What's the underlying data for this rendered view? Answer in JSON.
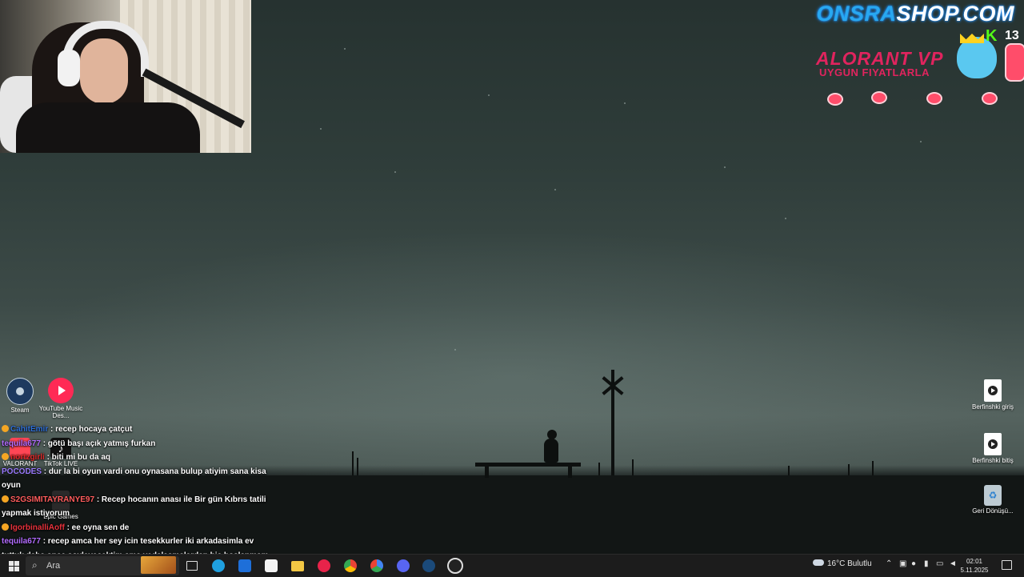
{
  "overlay": {
    "site_pre": "ONSRA",
    "site_post": "SHOP.COM",
    "game": "ALORANT VP",
    "subtitle": "UYGUN FIYATLARLA",
    "platform_letter": "K",
    "platform_number": "13"
  },
  "desktop_icons": [
    {
      "label": "Steam",
      "icon": "steam-icon"
    },
    {
      "label": "YouTube Music Des...",
      "icon": "youtube-music-icon"
    },
    {
      "label": "VALORANT",
      "icon": "valorant-icon"
    },
    {
      "label": "TikTok LIVE",
      "icon": "tiktok-icon"
    },
    {
      "label": "Epic Games",
      "icon": "epic-games-icon"
    },
    {
      "label": "Berfinshki giriş",
      "icon": "video-file-icon"
    },
    {
      "label": "Berfinshki bitiş",
      "icon": "video-file-icon"
    },
    {
      "label": "Geri Dönüşü...",
      "icon": "recycle-bin-icon"
    }
  ],
  "chat": {
    "messages": [
      {
        "user": "CahitEmir",
        "text": ": recep hocaya çatçut",
        "color": "#2f6fd6"
      },
      {
        "user": "tequila677",
        "text": ": götü başı açık yatmış furkan",
        "color": "#b26cff"
      },
      {
        "user": "nortzgirli",
        "text": ": biti mi bu da aq",
        "color": "#e02a2a"
      },
      {
        "user": "POCODES",
        "text": ": dur la bi oyun vardi onu oynasana bulup atiyim sana kisa oyun",
        "color": "#9b7bff"
      },
      {
        "user": "S2GSIMITAYRANYE97",
        "text": ": Recep hocanın anası ile Bir gün Kıbrıs tatili yapmak istiyorum",
        "color": "#ff5c5c"
      },
      {
        "user": "IgorbinalliAoff",
        "text": ": ee oyna sen de",
        "color": "#e8323c"
      },
      {
        "user": "tequila677",
        "text": ": recep amca her sey icin tesekkurler iki arkadasimla ev tuttuk daha once soyleyecektim ama vedalasmalardan hic hoslanmam bence sıkıntının tek sebebi yalnızlık",
        "color": "#b26cff"
      }
    ]
  },
  "taskbar": {
    "search_placeholder": "Ara",
    "weather": "16°C Bulutlu",
    "time": "02:01",
    "date": "5.11.2025",
    "apps": [
      {
        "name": "task-view-icon",
        "color": "#e0e0e0"
      },
      {
        "name": "edge-icon",
        "color": "#1fa0e0"
      },
      {
        "name": "outlook-icon",
        "color": "#1e6fd9"
      },
      {
        "name": "store-icon",
        "color": "#f3f3f3"
      },
      {
        "name": "file-explorer-icon",
        "color": "#f2c744"
      },
      {
        "name": "media-player-icon",
        "color": "#e8234a"
      },
      {
        "name": "chrome-icon",
        "color": "#34a853"
      },
      {
        "name": "chrome-profile-icon",
        "color": "#4285f4"
      },
      {
        "name": "discord-icon",
        "color": "#5865f2"
      },
      {
        "name": "steam-icon",
        "color": "#1b4a7a"
      },
      {
        "name": "obs-icon",
        "color": "#222222"
      }
    ]
  }
}
